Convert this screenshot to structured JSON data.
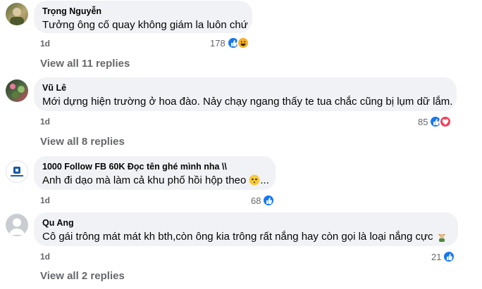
{
  "comments": [
    {
      "author": "Trọng Nguyễn",
      "text": "Tưởng ông cố quay không giám la luôn chứ",
      "time": "1d",
      "reaction_count": "178",
      "reactions": [
        "like-icon",
        "haha-icon"
      ]
    },
    {
      "author": "Vũ Lê",
      "text": "Mới dựng hiện trường ở hoa đào. Nảy chạy ngang thấy te tua chắc cũng bị lụm dữ lắm.",
      "time": "1d",
      "reaction_count": "85",
      "reactions": [
        "like-icon",
        "heart-icon"
      ],
      "view_replies": "View all 8 replies"
    },
    {
      "author": "1000 Follow FB 60K Đọc tên ghé mình nha \\\\",
      "text": "Anh đi dạo mà làm cả khu phố hồi hộp theo",
      "time": "1d",
      "reaction_count": "68",
      "reactions": [
        "like-icon"
      ]
    },
    {
      "author": "Qu Ang",
      "text": "Cô gái trông mát mát kh bth,còn ông kia trông rất nắng hay còn gọi là loại nắng cực",
      "time": "1d",
      "reaction_count": "21",
      "reactions": [
        "like-icon"
      ],
      "view_replies": "View all 2 replies"
    }
  ],
  "first_view_replies": "View all 11 replies",
  "colors": {
    "bubble": "#f0f2f5",
    "like": "#1877f2",
    "heart": "#f33e58",
    "meta": "#65676b"
  }
}
